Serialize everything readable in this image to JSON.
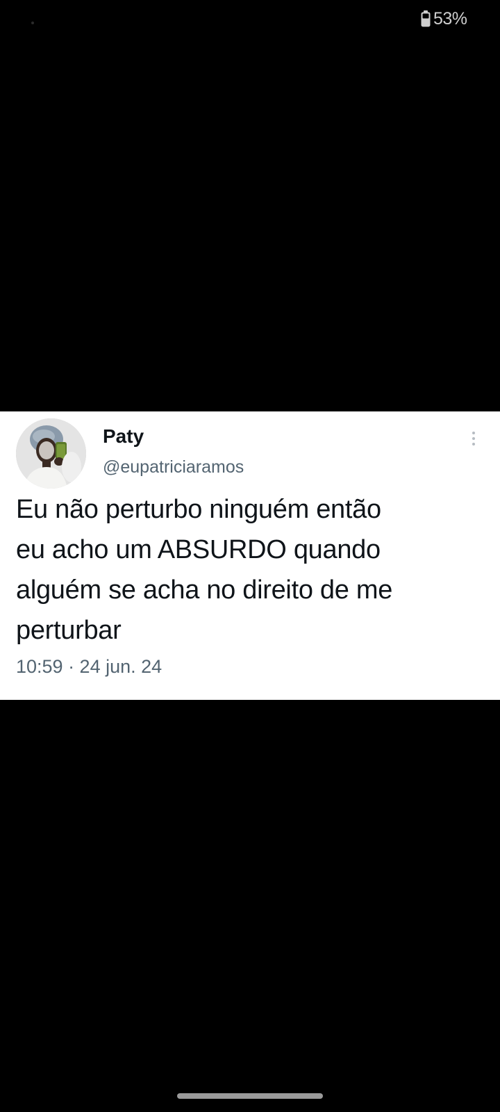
{
  "status_bar": {
    "battery_percent": "53%",
    "battery_icon": "battery-icon"
  },
  "tweet": {
    "author": {
      "display_name": "Paty",
      "handle": "@eupatriciaramos",
      "avatar_icon": "avatar-photo"
    },
    "text_lines": [
      "Eu não perturbo ninguém então",
      "eu acho um ABSURDO quando",
      "alguém se acha no direito de me",
      "perturbar"
    ],
    "timestamp": "10:59 · 24 jun. 24",
    "more_icon": "more-vertical-icon"
  },
  "colors": {
    "background": "#000000",
    "card": "#ffffff",
    "text_primary": "#0f1419",
    "text_secondary": "#536471"
  }
}
